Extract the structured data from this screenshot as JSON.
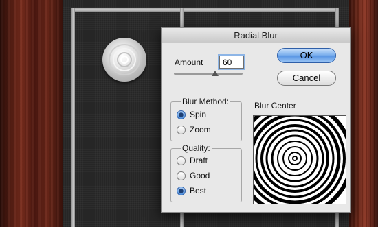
{
  "dialog": {
    "title": "Radial Blur",
    "amount_label": "Amount",
    "amount_value": "60",
    "amount_slider_fraction": 0.6,
    "ok_label": "OK",
    "cancel_label": "Cancel",
    "blur_method": {
      "title": "Blur Method:",
      "options": [
        {
          "label": "Spin",
          "selected": true
        },
        {
          "label": "Zoom",
          "selected": false
        }
      ]
    },
    "quality": {
      "title": "Quality:",
      "options": [
        {
          "label": "Draft",
          "selected": false
        },
        {
          "label": "Good",
          "selected": false
        },
        {
          "label": "Best",
          "selected": true
        }
      ]
    },
    "blur_center_label": "Blur Center"
  },
  "colors": {
    "accent_button": "#5a96e4",
    "wood": "#6f281a",
    "plate": "#262626"
  }
}
